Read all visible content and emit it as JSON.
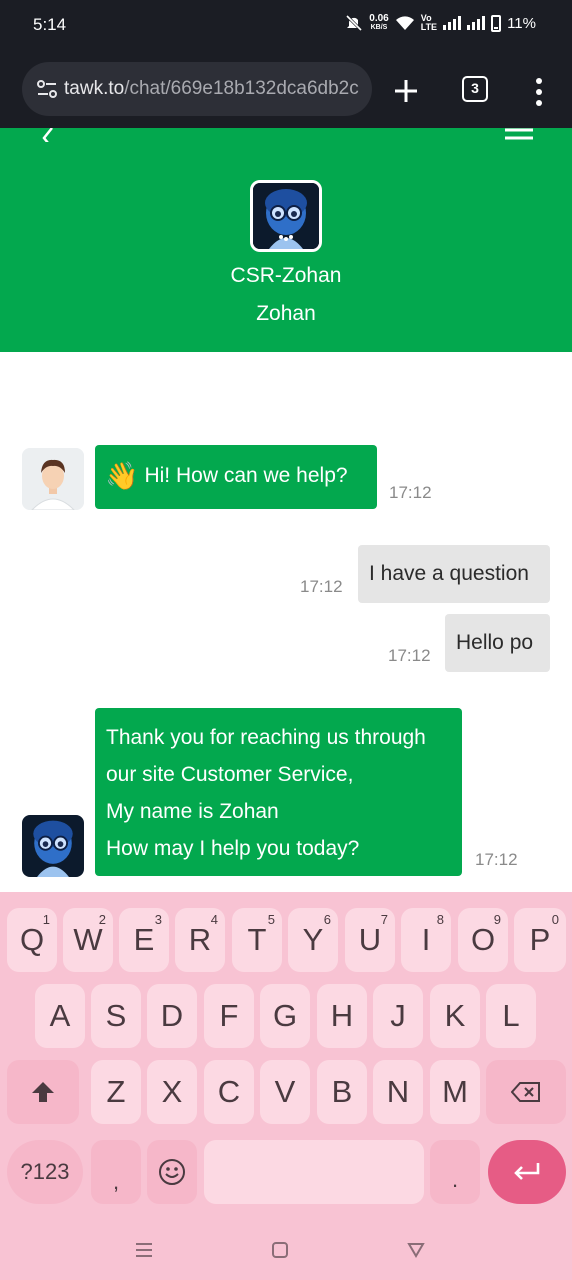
{
  "status_bar": {
    "time": "5:14",
    "net_speed_value": "0.06",
    "net_speed_unit": "KB/S",
    "lte_top": "Vo",
    "lte_bottom": "LTE",
    "battery": "11%"
  },
  "browser": {
    "url_host": "tawk.to",
    "url_path": "/chat/669e18b132dca6db2c",
    "tab_count": "3"
  },
  "chat_header": {
    "title": "CSR-Zohan",
    "subtitle": "Zohan"
  },
  "messages": [
    {
      "sender": "agent",
      "emoji": "👋",
      "text": "Hi! How can we help?",
      "time": "17:12"
    },
    {
      "sender": "visitor",
      "text": "I have a question",
      "time": "17:12"
    },
    {
      "sender": "visitor",
      "text": "Hello po",
      "time": "17:12"
    },
    {
      "sender": "agent",
      "lines": [
        "Thank you for reaching us through",
        "our site Customer Service,",
        "My name is Zohan",
        "How may I help you today?"
      ],
      "time": "17:12"
    }
  ],
  "keyboard": {
    "row1": [
      {
        "key": "Q",
        "hint": "1"
      },
      {
        "key": "W",
        "hint": "2"
      },
      {
        "key": "E",
        "hint": "3"
      },
      {
        "key": "R",
        "hint": "4"
      },
      {
        "key": "T",
        "hint": "5"
      },
      {
        "key": "Y",
        "hint": "6"
      },
      {
        "key": "U",
        "hint": "7"
      },
      {
        "key": "I",
        "hint": "8"
      },
      {
        "key": "O",
        "hint": "9"
      },
      {
        "key": "P",
        "hint": "0"
      }
    ],
    "row2": [
      "A",
      "S",
      "D",
      "F",
      "G",
      "H",
      "J",
      "K",
      "L"
    ],
    "row3": [
      "Z",
      "X",
      "C",
      "V",
      "B",
      "N",
      "M"
    ],
    "symbols_label": "?123",
    "comma_label": ",",
    "period_label": ".",
    "colors": {
      "background": "#f8c3d3",
      "key": "#fcd9e3",
      "enter": "#e65c85"
    }
  },
  "icons": {
    "status": [
      "mute-icon",
      "wifi-icon",
      "signal-icon",
      "battery-icon"
    ],
    "browser": [
      "site-settings-icon",
      "new-tab-plus-icon",
      "tab-switcher-icon",
      "more-menu-icon"
    ],
    "header": [
      "back-arrow-icon",
      "hamburger-menu-icon"
    ],
    "navbar": [
      "recents-icon",
      "home-icon",
      "back-icon"
    ]
  },
  "colors": {
    "brand_green": "#03a84e",
    "visitor_bubble": "#e5e5e5",
    "chrome_dark": "#1b1d24"
  }
}
